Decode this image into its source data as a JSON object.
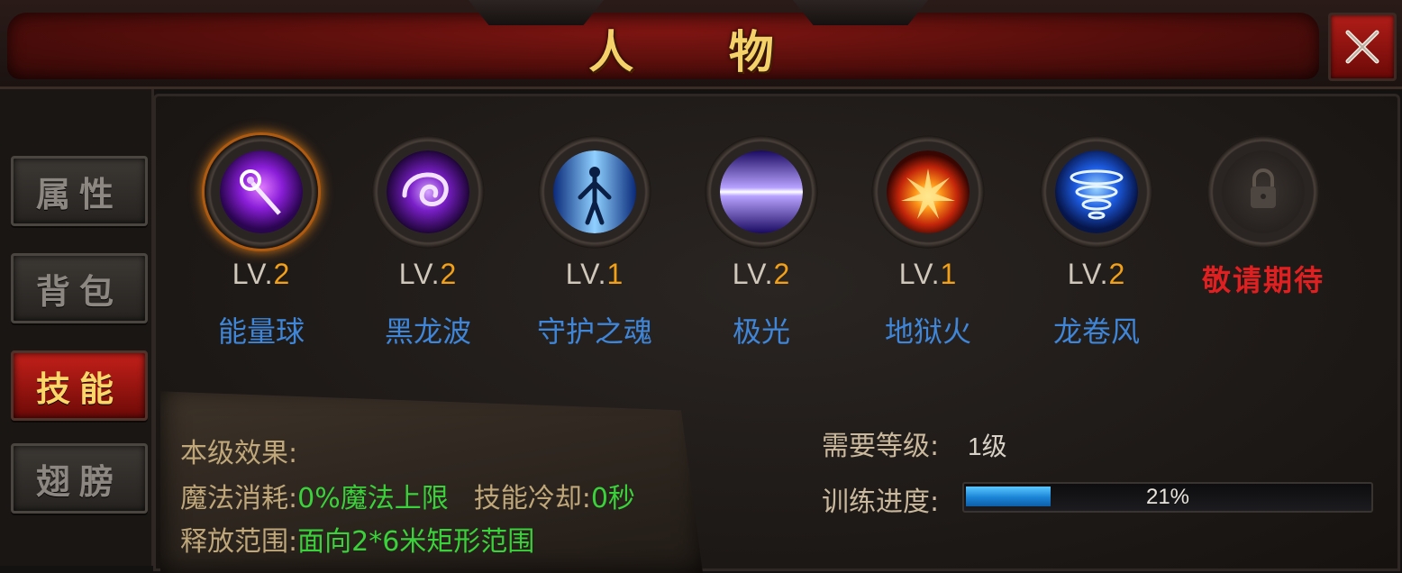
{
  "window": {
    "title": "人 物"
  },
  "tabs": [
    {
      "label": "属性",
      "active": false
    },
    {
      "label": "背包",
      "active": false
    },
    {
      "label": "技能",
      "active": true
    },
    {
      "label": "翅膀",
      "active": false
    }
  ],
  "skills": [
    {
      "lv_prefix": "LV.",
      "lv_num": "2",
      "name": "能量球",
      "icon": "energy-orb-icon",
      "selected": true
    },
    {
      "lv_prefix": "LV.",
      "lv_num": "2",
      "name": "黑龙波",
      "icon": "dark-dragon-wave-icon",
      "selected": false
    },
    {
      "lv_prefix": "LV.",
      "lv_num": "1",
      "name": "守护之魂",
      "icon": "guardian-soul-icon",
      "selected": false
    },
    {
      "lv_prefix": "LV.",
      "lv_num": "2",
      "name": "极光",
      "icon": "aurora-icon",
      "selected": false
    },
    {
      "lv_prefix": "LV.",
      "lv_num": "1",
      "name": "地狱火",
      "icon": "hellfire-icon",
      "selected": false
    },
    {
      "lv_prefix": "LV.",
      "lv_num": "2",
      "name": "龙卷风",
      "icon": "tornado-icon",
      "selected": false
    },
    {
      "locked_text": "敬请期待",
      "icon": "lock-icon"
    }
  ],
  "description": {
    "header": "本级效果:",
    "mana_label": "魔法消耗:",
    "mana_value": "0%魔法上限",
    "cooldown_label": "技能冷却:",
    "cooldown_value": "0秒",
    "range_label": "释放范围:",
    "range_value": "面向2*6米矩形范围"
  },
  "requirements": {
    "level_label": "需要等级:",
    "level_value": "1级",
    "progress_label": "训练进度:",
    "progress_text": "21%",
    "progress_fraction": 0.21
  },
  "colors": {
    "title_gold": "#f5d16a",
    "skill_name_blue": "#3f86d8",
    "level_orange": "#f1a018",
    "coming_soon_red": "#e02020",
    "effect_green": "#3ad23a",
    "progress_blue": "#1b84d6"
  }
}
